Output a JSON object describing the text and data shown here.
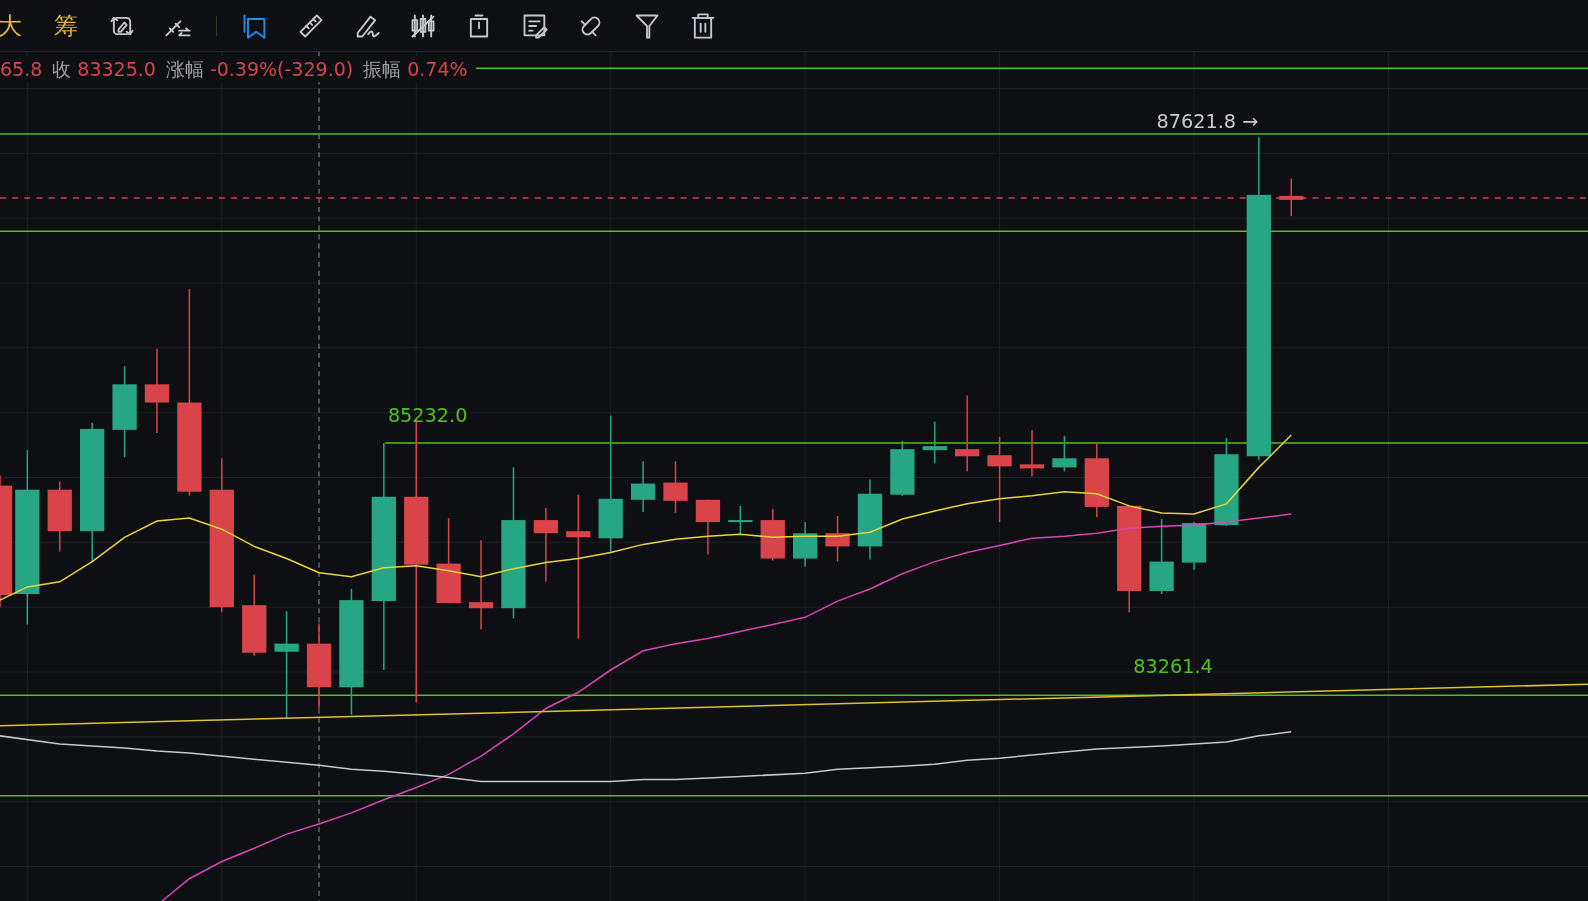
{
  "toolbar": {
    "text_buttons": [
      {
        "label": "大"
      },
      {
        "label": "筹"
      }
    ],
    "icons": [
      {
        "selected": false
      },
      {
        "selected": false
      },
      {
        "selected": true
      },
      {
        "selected": false
      },
      {
        "selected": false
      },
      {
        "selected": false
      },
      {
        "selected": false
      },
      {
        "selected": false
      },
      {
        "selected": false
      },
      {
        "selected": false
      },
      {
        "selected": false
      }
    ]
  },
  "ohlc_header": [
    {
      "kind": "value",
      "text": "65.8"
    },
    {
      "kind": "label",
      "text": "收"
    },
    {
      "kind": "value",
      "text": "83325.0"
    },
    {
      "kind": "label",
      "text": "涨幅"
    },
    {
      "kind": "value",
      "text": "-0.39%(-329.0)"
    },
    {
      "kind": "label",
      "text": "振幅"
    },
    {
      "kind": "value",
      "text": "0.74%"
    }
  ],
  "price_labels": [
    {
      "kind": "high",
      "text": "87621.8 →"
    },
    {
      "kind": "level",
      "text": "85232.0"
    },
    {
      "kind": "level",
      "text": "83261.4"
    }
  ]
}
